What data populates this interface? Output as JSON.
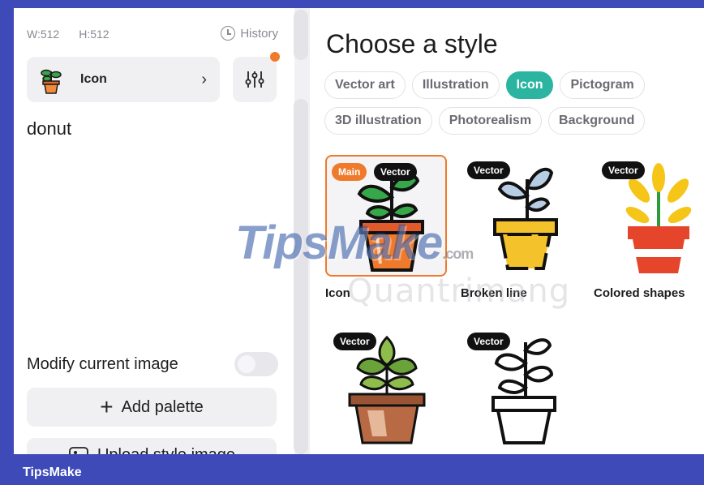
{
  "canvas": {
    "width_label": "W:512",
    "height_label": "H:512"
  },
  "history": {
    "label": "History",
    "icon": "clock-icon"
  },
  "style_select": {
    "label": "Icon",
    "icon": "potted-plant-icon",
    "chevron": "›"
  },
  "settings": {
    "icon": "sliders-icon",
    "notification_dot_color": "#f07a2b"
  },
  "prompt": {
    "text": "donut"
  },
  "modify": {
    "label": "Modify current image",
    "enabled": false
  },
  "add_palette": {
    "label": "Add palette",
    "icon": "plus-icon"
  },
  "upload_style": {
    "label": "Upload style image",
    "icon": "image-icon"
  },
  "main": {
    "title": "Choose a style",
    "chips": [
      {
        "label": "Vector art",
        "active": false
      },
      {
        "label": "Illustration",
        "active": false
      },
      {
        "label": "Icon",
        "active": true
      },
      {
        "label": "Pictogram",
        "active": false
      },
      {
        "label": "3D illustration",
        "active": false
      },
      {
        "label": "Photorealism",
        "active": false
      },
      {
        "label": "Background",
        "active": false
      }
    ],
    "styles": [
      {
        "name": "Icon",
        "badge": "Vector",
        "main_badge": "Main",
        "selected": true
      },
      {
        "name": "Broken line",
        "badge": "Vector",
        "selected": false
      },
      {
        "name": "Colored shapes",
        "badge": "Vector",
        "selected": false
      },
      {
        "name": "",
        "badge": "Vector",
        "selected": false
      },
      {
        "name": "",
        "badge": "Vector",
        "selected": false
      }
    ]
  },
  "watermark": {
    "brand": "TipsMake",
    "domain": ".com",
    "secondary": "Quantrimang"
  },
  "footer": {
    "brand": "TipsMake"
  },
  "colors": {
    "accent": "#2bb5a0",
    "selected_border": "#f07a2b",
    "frame": "#3d4ab8"
  }
}
